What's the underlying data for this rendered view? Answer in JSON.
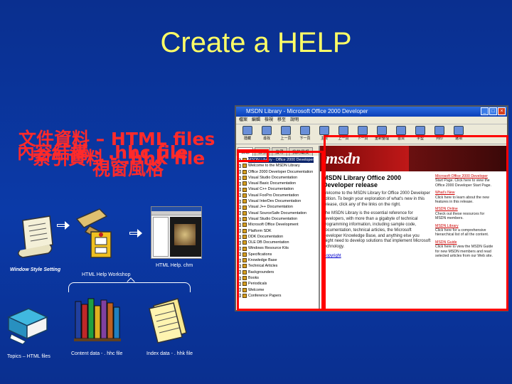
{
  "slide": {
    "title": "Create a HELP",
    "overlap_lines": [
      "文件資料 – HTML files",
      "內容結構 - .hhc file",
      "索引資料 - .hhk file",
      "視窗風格"
    ]
  },
  "captions": {
    "window_style": "Window Style Setting",
    "workshop": "HTML Help Workshop",
    "output": "HTML Help. chm",
    "topics": "Topics – HTML files",
    "content": "Content data - . hhc file",
    "index": "Index data - . hhk file"
  },
  "window": {
    "title": "MSDN Library - Microsoft Office 2000 Developer",
    "menu": [
      "檔案",
      "編輯",
      "檢視",
      "移至",
      "說明"
    ],
    "toolbar": [
      "隱藏",
      "尋找",
      "上一頁",
      "下一頁",
      "主頁",
      "上一頁",
      "下一頁",
      "重新整理",
      "首頁",
      "字型",
      "列印",
      "選項"
    ],
    "nav_tabs": [
      "目錄",
      "索引",
      "搜尋",
      "我的最愛"
    ],
    "tree": [
      "MSDN Library - Office 2000 Developer",
      "Welcome to the MSDN Library",
      "Office 2000 Developer Documentation",
      "Visual Studio Documentation",
      "Visual Basic Documentation",
      "Visual C++ Documentation",
      "Visual FoxPro Documentation",
      "Visual InterDev Documentation",
      "Visual J++ Documentation",
      "Visual SourceSafe Documentation",
      "Visual Studio Documentation",
      "Microsoft Office Development",
      "Platform SDK",
      "DDK Documentation",
      "OLE DB Documentation",
      "Windows Resource Kits",
      "Specifications",
      "Knowledge Base",
      "Technical Articles",
      "Backgrounders",
      "Books",
      "Periodicals",
      "Welcome",
      "Conference Papers"
    ],
    "banner": "msdn",
    "main_heading": "MSDN Library Office 2000 Developer release",
    "main_p1": "Welcome to the MSDN Library for Office 2000 Developer edition. To begin your exploration of what's new in this release, click any of the links on the right.",
    "main_p2": "The MSDN Library is the essential reference for developers, with more than a gigabyte of technical programming information, including sample code, documentation, technical articles, the Microsoft Developer Knowledge Base, and anything else you might need to develop solutions that implement Microsoft technology.",
    "copyright": "Copyright",
    "side": [
      {
        "link": "Microsoft Office 2000 Developer",
        "text": "Start Page. Click here to view the Office 2000 Developer Start Page."
      },
      {
        "link": "What's New",
        "text": "Click here to learn about the new features in this release."
      },
      {
        "link": "MSDN Online",
        "text": "Check out these resources for MSDN members."
      },
      {
        "link": "MSDN Library",
        "text": "Click here for a comprehensive hierarchical list of all the content."
      },
      {
        "link": "MSDN Guide",
        "text": "Click here to view the MSDN Guide for new MSDN members and read selected articles from our Web site."
      }
    ]
  }
}
